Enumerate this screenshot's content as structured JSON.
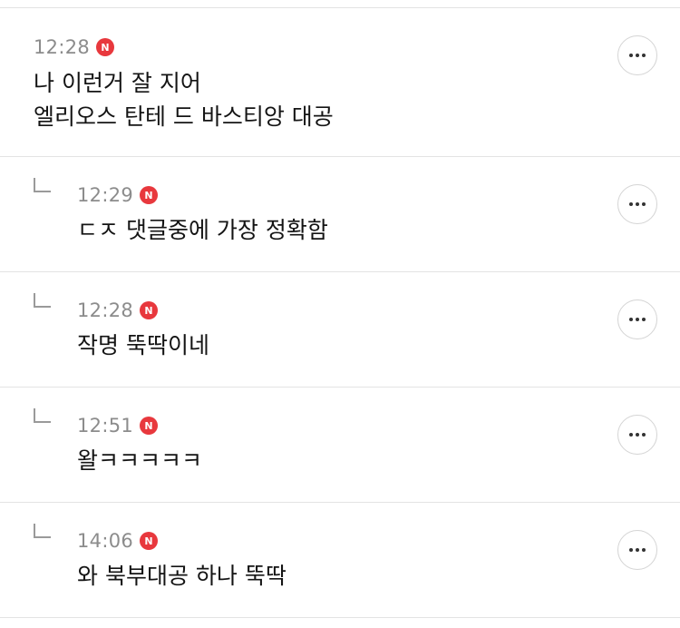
{
  "comments": [
    {
      "time": "12:28",
      "badge": "N",
      "lines": [
        "나 이런거 잘 지어",
        "엘리오스 탄테 드 바스티앙 대공"
      ],
      "reply": false
    },
    {
      "time": "12:29",
      "badge": "N",
      "lines": [
        "ㄷㅈ 댓글중에 가장 정확함"
      ],
      "reply": true
    },
    {
      "time": "12:28",
      "badge": "N",
      "lines": [
        "작명 뚝딱이네"
      ],
      "reply": true
    },
    {
      "time": "12:51",
      "badge": "N",
      "lines": [
        "왈ㅋㅋㅋㅋㅋ"
      ],
      "reply": true
    },
    {
      "time": "14:06",
      "badge": "N",
      "lines": [
        "와 북부대공 하나 뚝딱"
      ],
      "reply": true
    }
  ],
  "icons": {
    "reply": "reply-arrow-icon",
    "more": "more-options-icon",
    "badge": "new-badge-icon"
  },
  "colors": {
    "badge": "#e8383d",
    "time": "#8c8c8c",
    "divider": "#e3e3e3"
  }
}
